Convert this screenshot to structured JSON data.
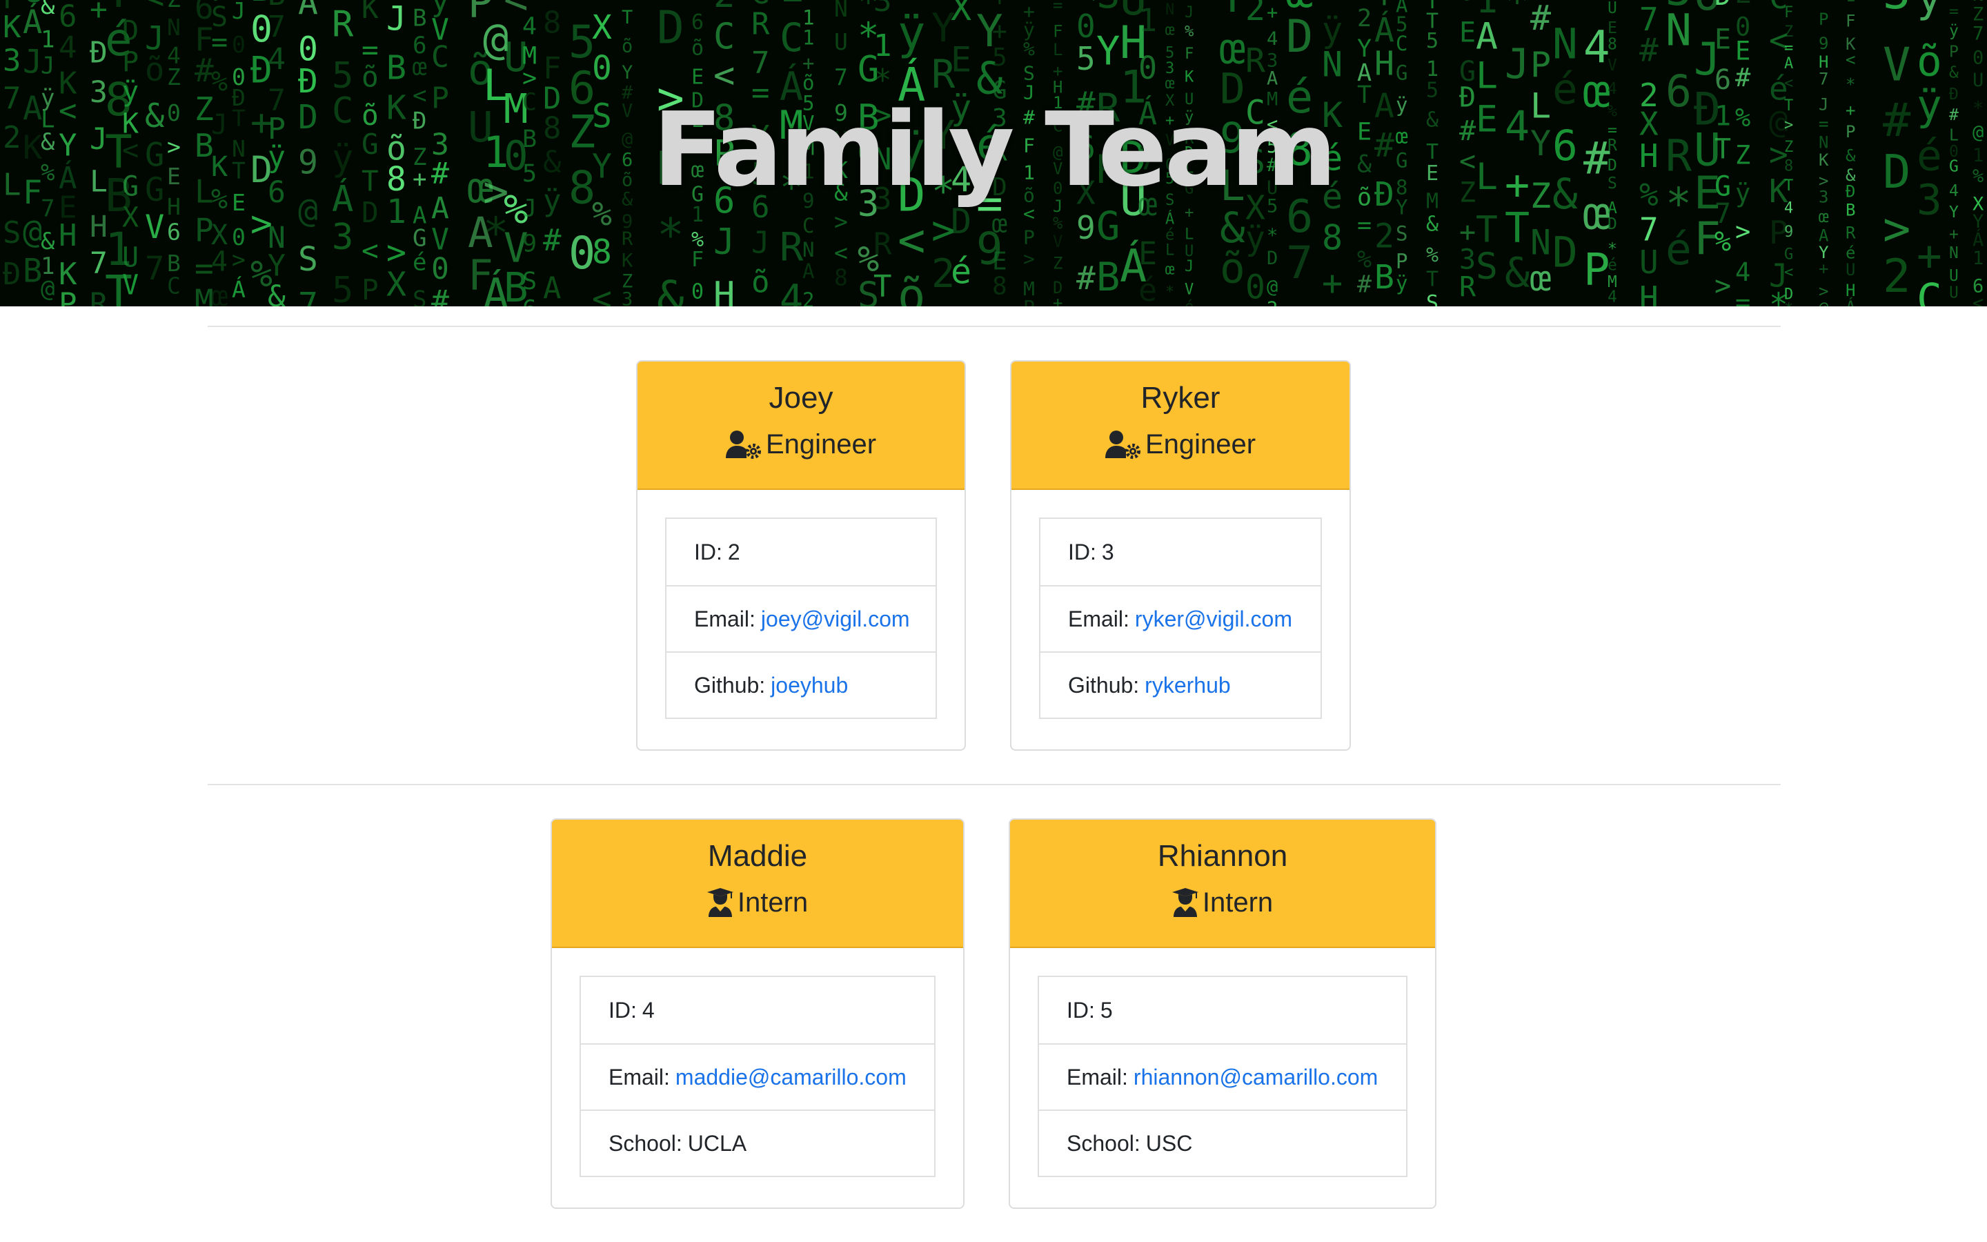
{
  "header": {
    "title": "Family Team"
  },
  "colors": {
    "card_header": "#fdc02f",
    "link": "#1a73e8",
    "hero_text": "#d6d6d6"
  },
  "cards": [
    {
      "name": "Joey",
      "role": "Engineer",
      "role_icon": "user-gear-icon",
      "id_label": "ID:",
      "id": "2",
      "email_label": "Email:",
      "email": "joey@vigil.com",
      "extra_label": "Github:",
      "extra": "joeyhub",
      "extra_is_link": true
    },
    {
      "name": "Ryker",
      "role": "Engineer",
      "role_icon": "user-gear-icon",
      "id_label": "ID:",
      "id": "3",
      "email_label": "Email:",
      "email": "ryker@vigil.com",
      "extra_label": "Github:",
      "extra": "rykerhub",
      "extra_is_link": true
    },
    {
      "name": "Maddie",
      "role": "Intern",
      "role_icon": "graduate-icon",
      "id_label": "ID:",
      "id": "4",
      "email_label": "Email:",
      "email": "maddie@camarillo.com",
      "extra_label": "School:",
      "extra": "UCLA",
      "extra_is_link": false
    },
    {
      "name": "Rhiannon",
      "role": "Intern",
      "role_icon": "graduate-icon",
      "id_label": "ID:",
      "id": "5",
      "email_label": "Email:",
      "email": "rhiannon@camarillo.com",
      "extra_label": "School:",
      "extra": "USC",
      "extra_is_link": false
    }
  ]
}
